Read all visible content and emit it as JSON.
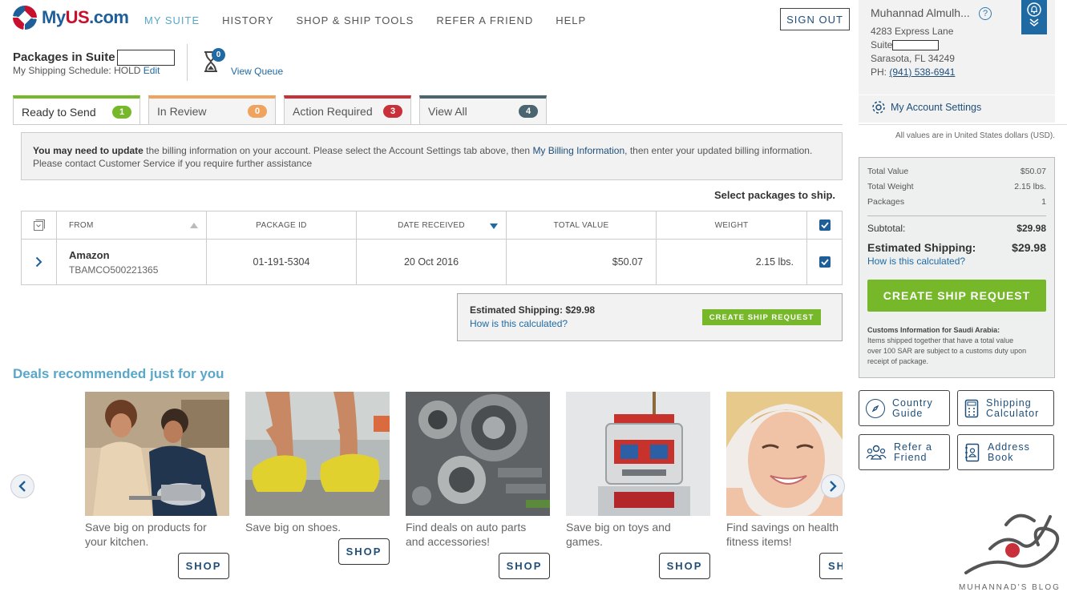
{
  "brand": {
    "name_prefix": "My",
    "name_us": "US",
    "name_suffix": ".com"
  },
  "nav": [
    {
      "label": "MY SUITE",
      "active": true
    },
    {
      "label": "HISTORY"
    },
    {
      "label": "SHOP & SHIP TOOLS"
    },
    {
      "label": "REFER A FRIEND"
    },
    {
      "label": "HELP"
    }
  ],
  "header": {
    "signout_label": "SIGN OUT"
  },
  "account": {
    "name": "Muhannad Almulh...",
    "help_glyph": "?",
    "street": "4283 Express Lane",
    "suite_label": "Suite",
    "city": "Sarasota, FL 34249",
    "phone_label": "PH:",
    "phone": "(941) 538-6941",
    "settings_label": "My Account Settings"
  },
  "currency_note": "All values are in United States dollars (USD).",
  "suite": {
    "title": "Packages in Suite",
    "schedule_text": "My Shipping Schedule: HOLD",
    "edit_label": "Edit",
    "queue_count": "0",
    "view_queue_label": "View Queue"
  },
  "tabs": [
    {
      "label": "Ready to Send",
      "count": "1",
      "color": "#76b82a",
      "active": true
    },
    {
      "label": "In Review",
      "count": "0",
      "color": "#f0a35e"
    },
    {
      "label": "Action Required",
      "count": "3",
      "color": "#c8303a"
    },
    {
      "label": "View All",
      "count": "4",
      "color": "#4a6470"
    }
  ],
  "notice": {
    "bold": "You may need to update",
    "text1": " the billing information on your account. Please select the Account Settings tab above, then ",
    "link": "My Billing Information",
    "text2": ", then enter your updated billing information. Please contact Customer Service if you require further assistance"
  },
  "table": {
    "select_label": "Select packages to ship.",
    "headers": {
      "from": "FROM",
      "package_id": "PACKAGE ID",
      "date_received": "DATE RECEIVED",
      "total_value": "TOTAL VALUE",
      "weight": "WEIGHT"
    },
    "rows": [
      {
        "from": "Amazon",
        "tracking": "TBAMCO500221365",
        "package_id": "01-191-5304",
        "date_received": "20 Oct 2016",
        "total_value": "$50.07",
        "weight": "2.15 lbs.",
        "checked": true
      }
    ]
  },
  "ship_box": {
    "estimated_label": "Estimated Shipping: $29.98",
    "how_label": "How is this calculated?",
    "button_label": "CREATE SHIP REQUEST"
  },
  "deals": {
    "title": "Deals recommended just for you",
    "shop_label": "SHOP",
    "partial_shop_label": "SH",
    "cards": [
      {
        "text": "Save big on products for your kitchen."
      },
      {
        "text": "Save big on shoes."
      },
      {
        "text": "Find deals on auto parts and accessories!"
      },
      {
        "text": "Save big on toys and games."
      },
      {
        "text": "Find savings on health fitness items!"
      }
    ]
  },
  "summary": {
    "total_value_label": "Total Value",
    "total_value": "$50.07",
    "total_weight_label": "Total Weight",
    "total_weight": "2.15 lbs.",
    "packages_label": "Packages",
    "packages": "1",
    "subtotal_label": "Subtotal:",
    "subtotal": "$29.98",
    "est_label": "Estimated Shipping:",
    "est": "$29.98",
    "how_label": "How is this calculated?",
    "button_label": "CREATE SHIP REQUEST",
    "customs_title": "Customs Information for Saudi Arabia:",
    "customs_text": "Items shipped together that have a total value over 100 SAR are subject to a customs duty upon receipt of package."
  },
  "tools": [
    {
      "line1": "Country",
      "line2": "Guide",
      "icon": "compass-icon"
    },
    {
      "line1": "Shipping",
      "line2": "Calculator",
      "icon": "calculator-icon"
    },
    {
      "line1": "Refer a",
      "line2": "Friend",
      "icon": "people-icon"
    },
    {
      "line1": "Address",
      "line2": "Book",
      "icon": "address-book-icon"
    }
  ],
  "watermark": {
    "text": "MUHANNAD'S BLOG"
  }
}
